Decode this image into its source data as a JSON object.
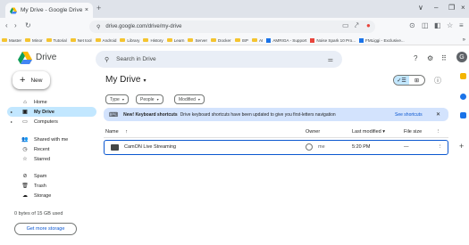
{
  "browser": {
    "tab_title": "My Drive - Google Drive",
    "new_tab": "+",
    "tab_close": "×",
    "url": "drive.google.com/drive/my-drive",
    "window_controls": [
      "∨",
      "–",
      "❐",
      "×"
    ],
    "bookmarks": [
      {
        "label": "Master",
        "kind": "folder"
      },
      {
        "label": "Minor",
        "kind": "folder"
      },
      {
        "label": "Tutorial",
        "kind": "folder"
      },
      {
        "label": "Net tool",
        "kind": "folder"
      },
      {
        "label": "Android",
        "kind": "folder"
      },
      {
        "label": "Library",
        "kind": "folder"
      },
      {
        "label": "History",
        "kind": "folder"
      },
      {
        "label": "Learn",
        "kind": "folder"
      },
      {
        "label": "Server",
        "kind": "folder"
      },
      {
        "label": "Docker",
        "kind": "folder"
      },
      {
        "label": "ISP",
        "kind": "folder"
      },
      {
        "label": "AI",
        "kind": "folder"
      },
      {
        "label": "AMRIGA - Support",
        "kind": "site"
      },
      {
        "label": "Noise Spark 10 Pro...",
        "kind": "site"
      },
      {
        "label": "FMLiggi - Exclusive...",
        "kind": "site"
      }
    ],
    "bookmarks_more": "»"
  },
  "header": {
    "app_name": "Drive",
    "search_placeholder": "Search in Drive",
    "avatar_letter": "G"
  },
  "sidebar": {
    "new_label": "New",
    "items": [
      {
        "label": "Home",
        "icon": "⌂"
      },
      {
        "label": "My Drive",
        "icon": "▣"
      },
      {
        "label": "Computers",
        "icon": "▭"
      },
      {
        "label": "Shared with me",
        "icon": "👥"
      },
      {
        "label": "Recent",
        "icon": "◷"
      },
      {
        "label": "Starred",
        "icon": "☆"
      },
      {
        "label": "Spam",
        "icon": "⊘"
      },
      {
        "label": "Trash",
        "icon": "🗑"
      },
      {
        "label": "Storage",
        "icon": "☁"
      }
    ],
    "storage_text": "0 bytes of 15 GB used",
    "storage_button": "Get more storage"
  },
  "main": {
    "title": "My Drive",
    "filters": [
      "Type",
      "People",
      "Modified"
    ],
    "banner": {
      "bold": "New! Keyboard shortcuts",
      "text": "Drive keyboard shortcuts have been updated to give you first-letters navigation",
      "action": "See shortcuts"
    },
    "columns": {
      "name": "Name",
      "sort_arrow": "↑",
      "owner": "Owner",
      "last_modified": "Last modified",
      "file_size": "File size"
    },
    "rows": [
      {
        "name": "CamON Live Streaming",
        "owner": "me",
        "modified": "5:20 PM",
        "size": "—"
      }
    ]
  },
  "colors": {
    "accent": "#0b57d0",
    "selected_nav": "#c2e7ff",
    "banner_bg": "#d3e3fd",
    "search_bg": "#e9eef6"
  }
}
